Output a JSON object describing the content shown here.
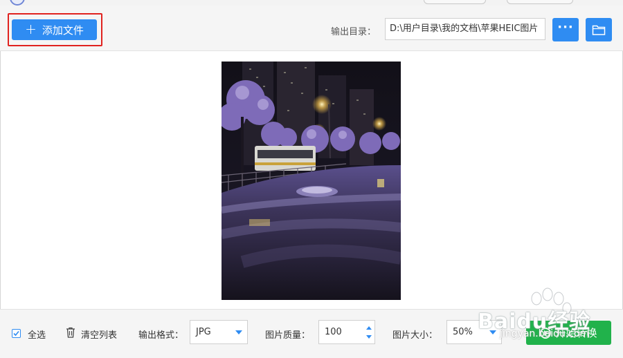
{
  "toolbar": {
    "add_file_label": "添加文件",
    "output_dir_label": "输出目录：",
    "output_dir_value": "D:\\用户目录\\我的文档\\苹果HEIC图片",
    "more_icon": "more-dots-icon",
    "folder_icon": "folder-icon"
  },
  "bottom": {
    "select_all_label": "全选",
    "clear_list_label": "清空列表",
    "output_format_label": "输出格式：",
    "output_format_value": "JPG",
    "quality_label": "图片质量：",
    "quality_value": "100",
    "size_label": "图片大小：",
    "size_value": "50%",
    "start_label": "开始转换"
  },
  "watermark": {
    "text": "Baidu经验",
    "sub": "jingyan.baidu.com"
  },
  "colors": {
    "accent": "#2f8cf2",
    "start": "#21b24b",
    "highlight": "#e0221f"
  }
}
